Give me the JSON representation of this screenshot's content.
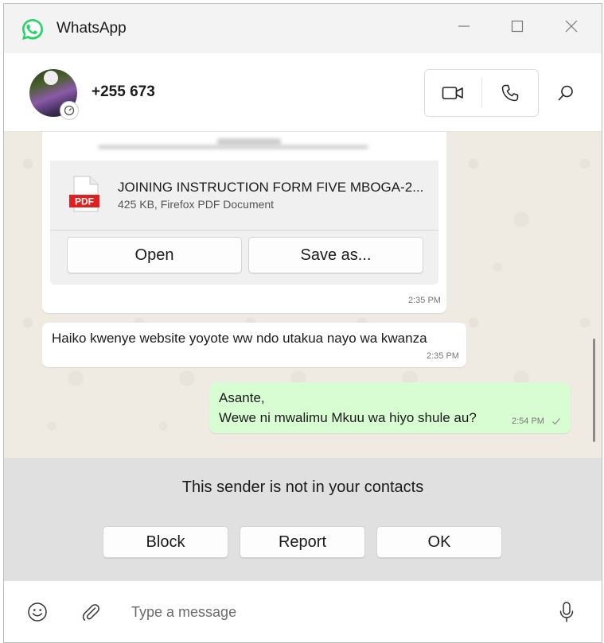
{
  "app": {
    "title": "WhatsApp",
    "brand_color": "#25d366"
  },
  "window_controls": [
    "minimize-icon",
    "maximize-icon",
    "close-icon"
  ],
  "header": {
    "contact_name": "+255 673",
    "actions": [
      "video-call-icon",
      "voice-call-icon",
      "search-icon"
    ]
  },
  "messages": [
    {
      "type": "document",
      "direction": "incoming",
      "file_name": "JOINING INSTRUCTION FORM FIVE MBOGA-2...",
      "file_meta": "425 KB, Firefox PDF Document",
      "file_icon_label": "PDF",
      "open_label": "Open",
      "save_label": "Save as...",
      "time": "2:35 PM"
    },
    {
      "type": "text",
      "direction": "incoming",
      "text": "Haiko kwenye website yoyote ww ndo utakua nayo wa kwanza",
      "time": "2:35 PM"
    },
    {
      "type": "text",
      "direction": "outgoing",
      "line1": "Asante,",
      "line2": "Wewe ni mwalimu Mkuu wa hiyo shule au?",
      "time": "2:54 PM",
      "status": "sent-check-icon"
    }
  ],
  "unknown_sender": {
    "text": "This sender is not in your contacts",
    "block_label": "Block",
    "report_label": "Report",
    "ok_label": "OK"
  },
  "composer": {
    "placeholder": "Type a message",
    "value": ""
  },
  "colors": {
    "chat_bg": "#efeae2",
    "outgoing_bubble": "#d9fdd3",
    "incoming_bubble": "#ffffff",
    "pdf_red": "#e02020"
  }
}
